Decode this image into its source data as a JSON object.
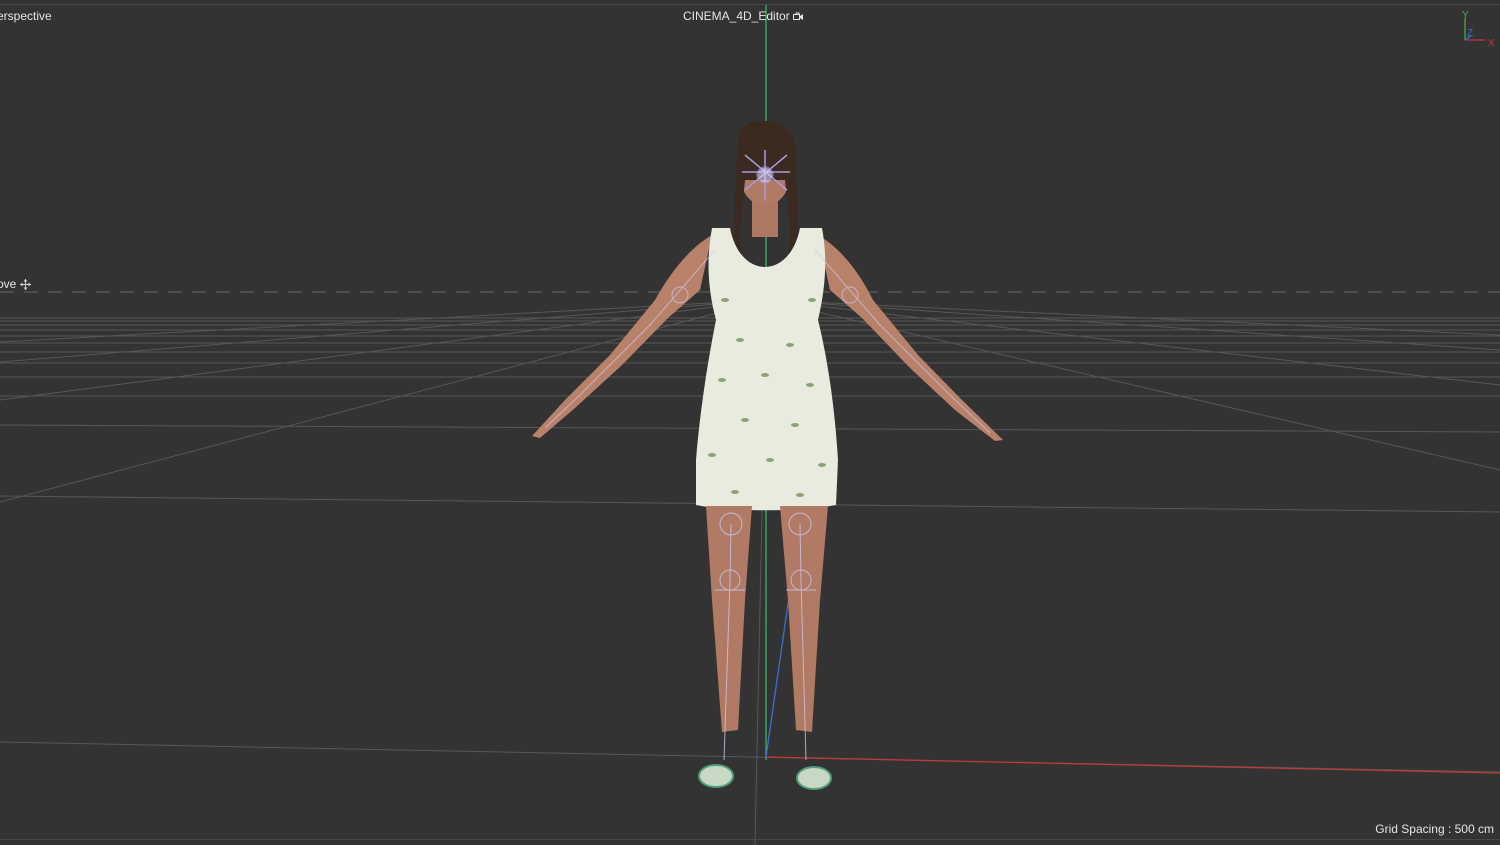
{
  "viewport": {
    "view_name": "erspective",
    "camera": "CINEMA_4D_Editor",
    "camera_icon": "camera-lock-icon",
    "tool": "ove",
    "tool_icon": "move-icon",
    "grid_spacing": "Grid Spacing : 500 cm"
  },
  "axes": {
    "x": "X",
    "y": "Y",
    "z": "Z"
  },
  "colors": {
    "background": "#333333",
    "y_axis": "#3fb35a",
    "x_axis": "#c0393b",
    "z_axis": "#3d6fd1",
    "grid": "#5a5a5a",
    "skin": "#b8816a",
    "dress": "#e8ebde",
    "hair": "#3a2a20",
    "joints": "#a99be0"
  }
}
